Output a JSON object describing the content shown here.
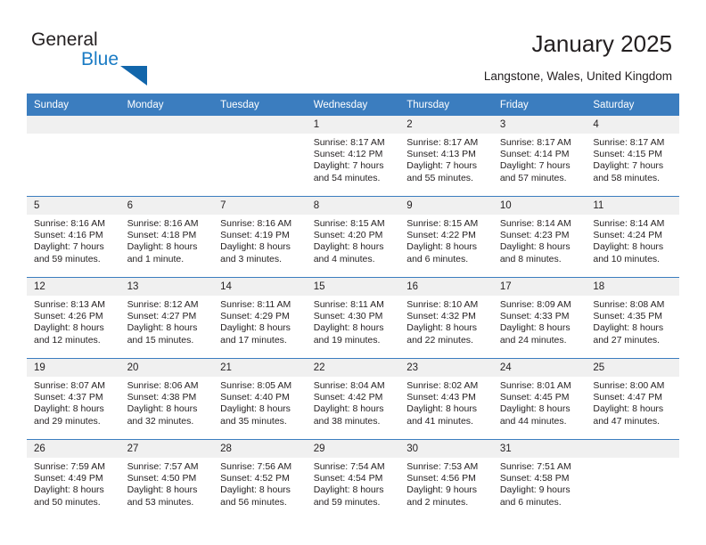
{
  "brand": {
    "name_part1": "General",
    "name_part2": "Blue"
  },
  "header": {
    "title": "January 2025",
    "location": "Langstone, Wales, United Kingdom"
  },
  "calendar": {
    "weekday_headers": [
      "Sunday",
      "Monday",
      "Tuesday",
      "Wednesday",
      "Thursday",
      "Friday",
      "Saturday"
    ],
    "accent_color": "#3b7dbf",
    "daynum_band_color": "#f0f0f0",
    "weeks": [
      [
        {
          "blank": true
        },
        {
          "blank": true
        },
        {
          "blank": true
        },
        {
          "day": "1",
          "sunrise": "Sunrise: 8:17 AM",
          "sunset": "Sunset: 4:12 PM",
          "daylight": "Daylight: 7 hours and 54 minutes."
        },
        {
          "day": "2",
          "sunrise": "Sunrise: 8:17 AM",
          "sunset": "Sunset: 4:13 PM",
          "daylight": "Daylight: 7 hours and 55 minutes."
        },
        {
          "day": "3",
          "sunrise": "Sunrise: 8:17 AM",
          "sunset": "Sunset: 4:14 PM",
          "daylight": "Daylight: 7 hours and 57 minutes."
        },
        {
          "day": "4",
          "sunrise": "Sunrise: 8:17 AM",
          "sunset": "Sunset: 4:15 PM",
          "daylight": "Daylight: 7 hours and 58 minutes."
        }
      ],
      [
        {
          "day": "5",
          "sunrise": "Sunrise: 8:16 AM",
          "sunset": "Sunset: 4:16 PM",
          "daylight": "Daylight: 7 hours and 59 minutes."
        },
        {
          "day": "6",
          "sunrise": "Sunrise: 8:16 AM",
          "sunset": "Sunset: 4:18 PM",
          "daylight": "Daylight: 8 hours and 1 minute."
        },
        {
          "day": "7",
          "sunrise": "Sunrise: 8:16 AM",
          "sunset": "Sunset: 4:19 PM",
          "daylight": "Daylight: 8 hours and 3 minutes."
        },
        {
          "day": "8",
          "sunrise": "Sunrise: 8:15 AM",
          "sunset": "Sunset: 4:20 PM",
          "daylight": "Daylight: 8 hours and 4 minutes."
        },
        {
          "day": "9",
          "sunrise": "Sunrise: 8:15 AM",
          "sunset": "Sunset: 4:22 PM",
          "daylight": "Daylight: 8 hours and 6 minutes."
        },
        {
          "day": "10",
          "sunrise": "Sunrise: 8:14 AM",
          "sunset": "Sunset: 4:23 PM",
          "daylight": "Daylight: 8 hours and 8 minutes."
        },
        {
          "day": "11",
          "sunrise": "Sunrise: 8:14 AM",
          "sunset": "Sunset: 4:24 PM",
          "daylight": "Daylight: 8 hours and 10 minutes."
        }
      ],
      [
        {
          "day": "12",
          "sunrise": "Sunrise: 8:13 AM",
          "sunset": "Sunset: 4:26 PM",
          "daylight": "Daylight: 8 hours and 12 minutes."
        },
        {
          "day": "13",
          "sunrise": "Sunrise: 8:12 AM",
          "sunset": "Sunset: 4:27 PM",
          "daylight": "Daylight: 8 hours and 15 minutes."
        },
        {
          "day": "14",
          "sunrise": "Sunrise: 8:11 AM",
          "sunset": "Sunset: 4:29 PM",
          "daylight": "Daylight: 8 hours and 17 minutes."
        },
        {
          "day": "15",
          "sunrise": "Sunrise: 8:11 AM",
          "sunset": "Sunset: 4:30 PM",
          "daylight": "Daylight: 8 hours and 19 minutes."
        },
        {
          "day": "16",
          "sunrise": "Sunrise: 8:10 AM",
          "sunset": "Sunset: 4:32 PM",
          "daylight": "Daylight: 8 hours and 22 minutes."
        },
        {
          "day": "17",
          "sunrise": "Sunrise: 8:09 AM",
          "sunset": "Sunset: 4:33 PM",
          "daylight": "Daylight: 8 hours and 24 minutes."
        },
        {
          "day": "18",
          "sunrise": "Sunrise: 8:08 AM",
          "sunset": "Sunset: 4:35 PM",
          "daylight": "Daylight: 8 hours and 27 minutes."
        }
      ],
      [
        {
          "day": "19",
          "sunrise": "Sunrise: 8:07 AM",
          "sunset": "Sunset: 4:37 PM",
          "daylight": "Daylight: 8 hours and 29 minutes."
        },
        {
          "day": "20",
          "sunrise": "Sunrise: 8:06 AM",
          "sunset": "Sunset: 4:38 PM",
          "daylight": "Daylight: 8 hours and 32 minutes."
        },
        {
          "day": "21",
          "sunrise": "Sunrise: 8:05 AM",
          "sunset": "Sunset: 4:40 PM",
          "daylight": "Daylight: 8 hours and 35 minutes."
        },
        {
          "day": "22",
          "sunrise": "Sunrise: 8:04 AM",
          "sunset": "Sunset: 4:42 PM",
          "daylight": "Daylight: 8 hours and 38 minutes."
        },
        {
          "day": "23",
          "sunrise": "Sunrise: 8:02 AM",
          "sunset": "Sunset: 4:43 PM",
          "daylight": "Daylight: 8 hours and 41 minutes."
        },
        {
          "day": "24",
          "sunrise": "Sunrise: 8:01 AM",
          "sunset": "Sunset: 4:45 PM",
          "daylight": "Daylight: 8 hours and 44 minutes."
        },
        {
          "day": "25",
          "sunrise": "Sunrise: 8:00 AM",
          "sunset": "Sunset: 4:47 PM",
          "daylight": "Daylight: 8 hours and 47 minutes."
        }
      ],
      [
        {
          "day": "26",
          "sunrise": "Sunrise: 7:59 AM",
          "sunset": "Sunset: 4:49 PM",
          "daylight": "Daylight: 8 hours and 50 minutes."
        },
        {
          "day": "27",
          "sunrise": "Sunrise: 7:57 AM",
          "sunset": "Sunset: 4:50 PM",
          "daylight": "Daylight: 8 hours and 53 minutes."
        },
        {
          "day": "28",
          "sunrise": "Sunrise: 7:56 AM",
          "sunset": "Sunset: 4:52 PM",
          "daylight": "Daylight: 8 hours and 56 minutes."
        },
        {
          "day": "29",
          "sunrise": "Sunrise: 7:54 AM",
          "sunset": "Sunset: 4:54 PM",
          "daylight": "Daylight: 8 hours and 59 minutes."
        },
        {
          "day": "30",
          "sunrise": "Sunrise: 7:53 AM",
          "sunset": "Sunset: 4:56 PM",
          "daylight": "Daylight: 9 hours and 2 minutes."
        },
        {
          "day": "31",
          "sunrise": "Sunrise: 7:51 AM",
          "sunset": "Sunset: 4:58 PM",
          "daylight": "Daylight: 9 hours and 6 minutes."
        },
        {
          "blank": true
        }
      ]
    ]
  }
}
